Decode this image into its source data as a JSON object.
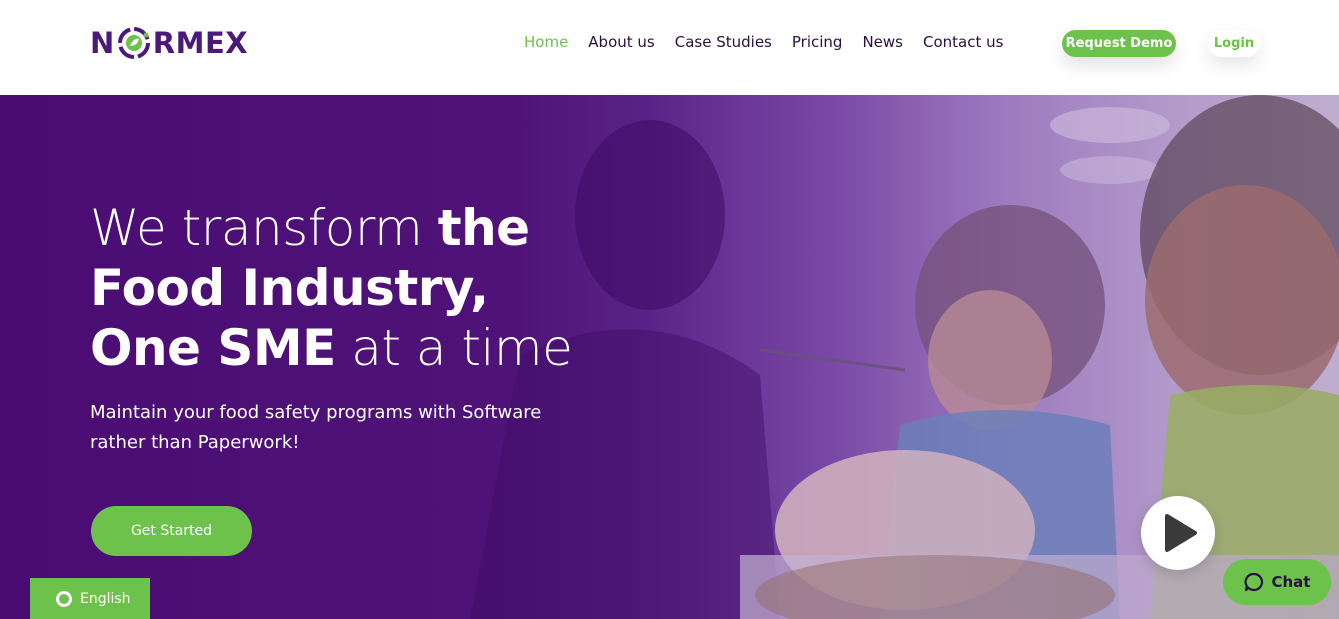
{
  "brand": {
    "logo_text_left": "N",
    "logo_text_right": "RMEX",
    "logo_alt": "NORMEX"
  },
  "nav": {
    "items": [
      {
        "label": "Home",
        "active": true
      },
      {
        "label": "About us",
        "active": false
      },
      {
        "label": "Case Studies",
        "active": false
      },
      {
        "label": "Pricing",
        "active": false
      },
      {
        "label": "News",
        "active": false
      },
      {
        "label": "Contact us",
        "active": false
      }
    ],
    "request_demo": "Request Demo",
    "login": "Login"
  },
  "hero": {
    "headline_1_light": "We transform ",
    "headline_1_bold": "the",
    "headline_2_bold": "Food Industry,",
    "headline_3_bold": "One SME",
    "headline_3_light": " at a time",
    "subhead": "Maintain your food safety programs with Software rather than Paperwork!",
    "cta": "Get Started"
  },
  "widgets": {
    "chat": "Chat",
    "language": "English"
  },
  "colors": {
    "brand_purple": "#4a1a7a",
    "accent_green": "#6cc24a",
    "hero_purple": "#4a0c73"
  },
  "icons": [
    "play-icon",
    "chat-bubble-icon",
    "language-ring-icon",
    "logo-leaf-icon"
  ]
}
